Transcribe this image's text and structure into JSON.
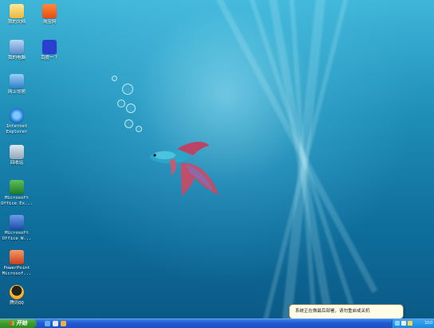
{
  "desktop": {
    "icons": [
      {
        "label": "我的文档",
        "icon": "folder-documents-icon"
      },
      {
        "label": "淘宝网",
        "icon": "taobao-icon"
      },
      {
        "label": "我的电脑",
        "icon": "computer-icon"
      },
      {
        "label": "百度一下",
        "icon": "baidu-icon"
      },
      {
        "label": "网上邻居",
        "icon": "network-icon"
      },
      {
        "label": "Internet\nExplorer",
        "icon": "internet-explorer-icon"
      },
      {
        "label": "回收站",
        "icon": "recycle-bin-icon"
      },
      {
        "label": "Microsoft\nOffice Ex...",
        "icon": "excel-icon"
      },
      {
        "label": "Microsoft\nOffice W...",
        "icon": "word-icon"
      },
      {
        "label": "PowerPoint\nMicrosof...",
        "icon": "powerpoint-icon"
      },
      {
        "label": "腾讯QQ",
        "icon": "qq-icon"
      }
    ]
  },
  "taskbar": {
    "start_label": "开始",
    "quicklaunch": [
      "internet-explorer-icon",
      "show-desktop-icon",
      "media-icon"
    ],
    "tray_icons": [
      "network-tray-icon",
      "volume-tray-icon",
      "security-tray-icon"
    ],
    "clock": "10:0"
  },
  "balloon": {
    "text": "系统正在做最后部署，请勿重启或关机"
  },
  "colors": {
    "taskbar_blue": "#2459d3",
    "start_green": "#3a9a2c",
    "tray_blue": "#1a8ae0",
    "balloon_bg": "#fffde8"
  }
}
